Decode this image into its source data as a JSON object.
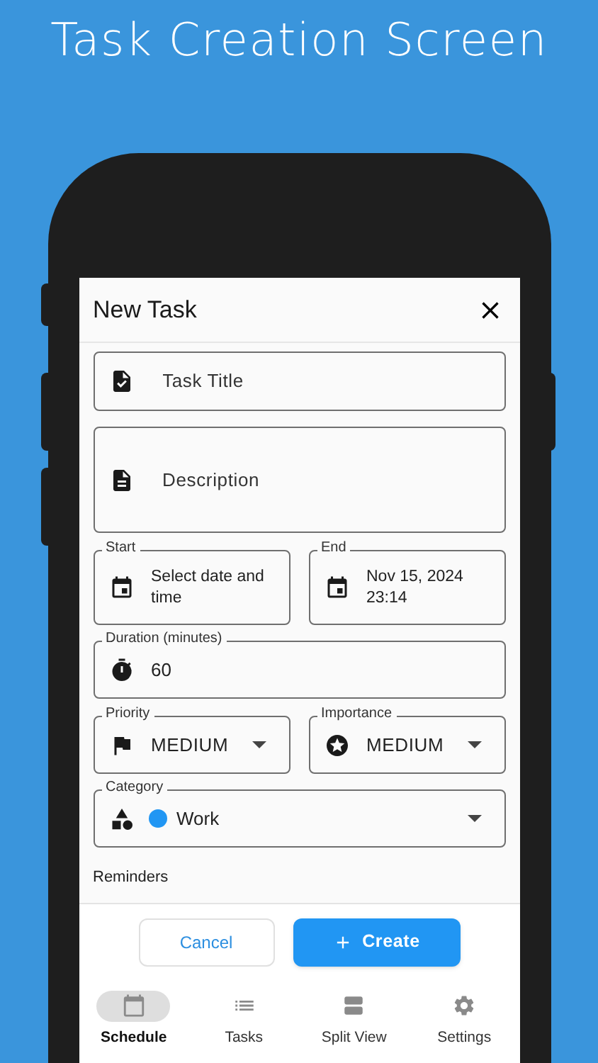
{
  "page_title": "Task Creation Screen",
  "dialog": {
    "title": "New Task"
  },
  "title_field": {
    "placeholder": "Task Title"
  },
  "description_field": {
    "placeholder": "Description"
  },
  "start": {
    "label": "Start",
    "value": "Select date and time"
  },
  "end": {
    "label": "End",
    "value": "Nov 15, 2024 23:14"
  },
  "duration": {
    "label": "Duration (minutes)",
    "value": "60"
  },
  "priority": {
    "label": "Priority",
    "value": "MEDIUM"
  },
  "importance": {
    "label": "Importance",
    "value": "MEDIUM"
  },
  "category": {
    "label": "Category",
    "value": "Work",
    "color": "#2196f3"
  },
  "reminders_heading": "Reminders",
  "actions": {
    "cancel": "Cancel",
    "create": "Create"
  },
  "nav": [
    {
      "kind": "calendar",
      "label": "Schedule",
      "selected": true
    },
    {
      "kind": "list",
      "label": "Tasks",
      "selected": false
    },
    {
      "kind": "split",
      "label": "Split View",
      "selected": false
    },
    {
      "kind": "settings",
      "label": "Settings",
      "selected": false
    }
  ]
}
